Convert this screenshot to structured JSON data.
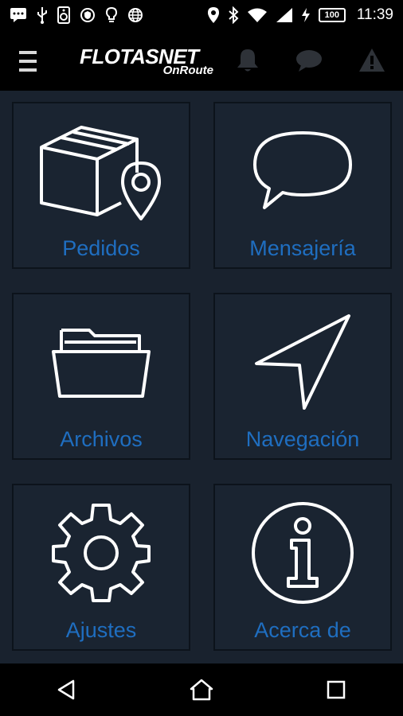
{
  "status_bar": {
    "time": "11:39",
    "battery": "100",
    "icons": [
      "message-icon",
      "usb-icon",
      "speaker-icon",
      "shield-icon",
      "bulb-icon",
      "globe-icon",
      "location-icon",
      "bluetooth-icon",
      "wifi-icon",
      "signal-icon",
      "charging-icon"
    ]
  },
  "app_bar": {
    "logo_main": "FLOTASNET",
    "logo_sub": "OnRoute",
    "icons": [
      "menu-icon",
      "bell-icon",
      "chat-icon",
      "warning-icon"
    ]
  },
  "menu": {
    "tiles": [
      {
        "label": "Pedidos",
        "icon": "package-location-icon"
      },
      {
        "label": "Mensajería",
        "icon": "speech-bubble-icon"
      },
      {
        "label": "Archivos",
        "icon": "folder-icon"
      },
      {
        "label": "Navegación",
        "icon": "navigation-arrow-icon"
      },
      {
        "label": "Ajustes",
        "icon": "gear-icon"
      },
      {
        "label": "Acerca de",
        "icon": "info-icon"
      }
    ]
  },
  "nav_bar": {
    "icons": [
      "back-icon",
      "home-icon",
      "recents-icon"
    ]
  },
  "colors": {
    "background": "#19222e",
    "tile_label": "#1f6ec0",
    "bars": "#000000"
  }
}
